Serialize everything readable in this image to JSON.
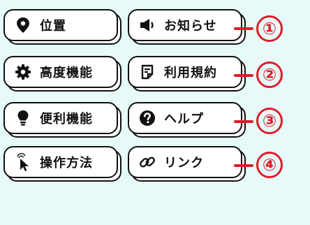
{
  "colors": {
    "background": "#e6fbf9",
    "accent": "#e01a2a",
    "text": "#111111"
  },
  "buttons": [
    {
      "label": "位置",
      "icon": "map-pin-icon"
    },
    {
      "label": "お知らせ",
      "icon": "speaker-icon"
    },
    {
      "label": "高度機能",
      "icon": "gear-icon"
    },
    {
      "label": "利用規約",
      "icon": "document-icon"
    },
    {
      "label": "便利機能",
      "icon": "lightbulb-icon"
    },
    {
      "label": "ヘルプ",
      "icon": "help-icon"
    },
    {
      "label": "操作方法",
      "icon": "pointer-icon"
    },
    {
      "label": "リンク",
      "icon": "link-icon"
    }
  ],
  "callouts": [
    "①",
    "②",
    "③",
    "④"
  ]
}
